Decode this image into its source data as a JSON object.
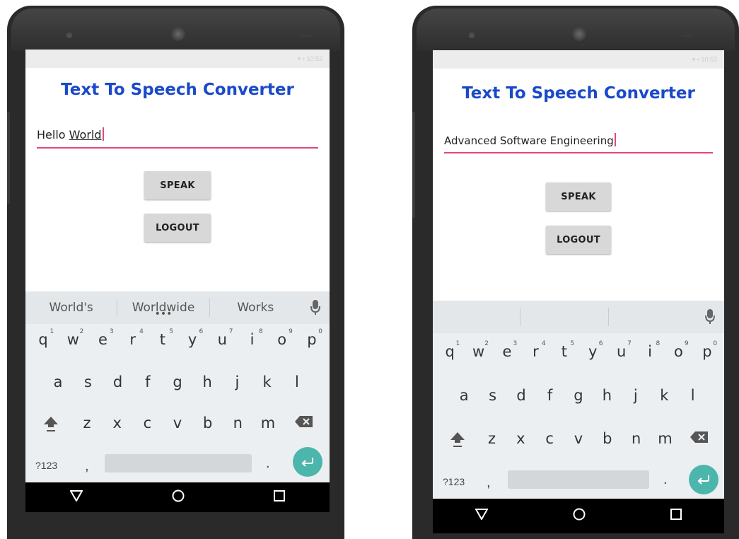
{
  "apps": [
    {
      "title": "Text To Speech Converter",
      "input_prefix": "Hello ",
      "input_underlined": "World",
      "speak_label": "SPEAK",
      "logout_label": "LOGOUT",
      "suggestions": [
        "World's",
        "Worldwide",
        "Works"
      ],
      "status": "▾ ▪ 10:52"
    },
    {
      "title": "Text To Speech Converter",
      "input_prefix": "Advanced Software Engineering",
      "input_underlined": "",
      "speak_label": "SPEAK",
      "logout_label": "LOGOUT",
      "suggestions": [
        "",
        "",
        ""
      ],
      "status": "▾ ▪ 10:53"
    }
  ],
  "keyboard": {
    "row1": [
      "q",
      "w",
      "e",
      "r",
      "t",
      "y",
      "u",
      "i",
      "o",
      "p"
    ],
    "row1_hints": [
      "1",
      "2",
      "3",
      "4",
      "5",
      "6",
      "7",
      "8",
      "9",
      "0"
    ],
    "row2": [
      "a",
      "s",
      "d",
      "f",
      "g",
      "h",
      "j",
      "k",
      "l"
    ],
    "row3": [
      "z",
      "x",
      "c",
      "v",
      "b",
      "n",
      "m"
    ],
    "symbols_label": "?123",
    "comma": ",",
    "period": "."
  },
  "icons": {
    "mic": "mic-icon",
    "shift": "shift-icon",
    "backspace": "backspace-icon",
    "enter": "enter-icon",
    "back": "back-triangle-icon",
    "home": "home-circle-icon",
    "recents": "recents-square-icon"
  },
  "colors": {
    "title": "#1a49c9",
    "accent": "#e0487f",
    "enter": "#4db6ac"
  }
}
